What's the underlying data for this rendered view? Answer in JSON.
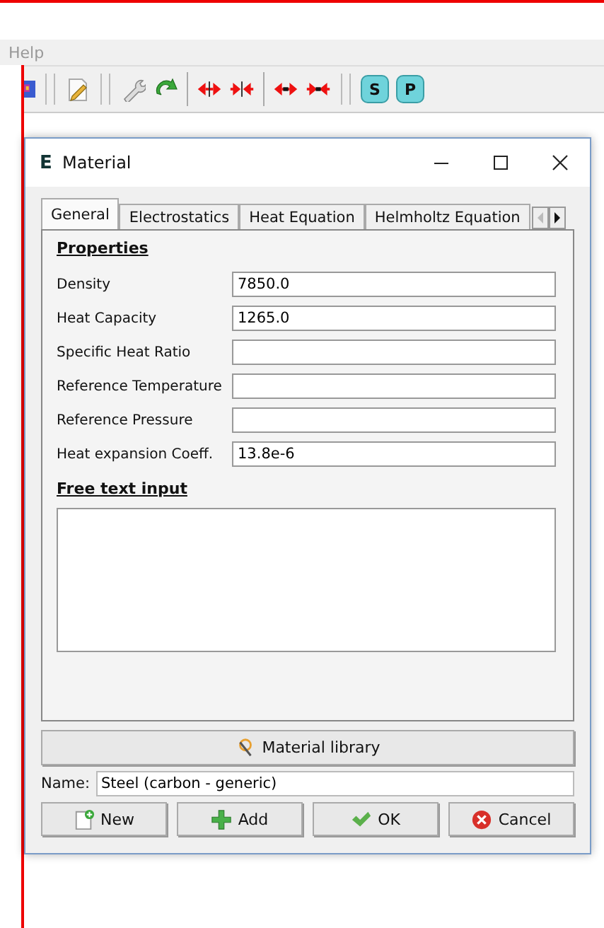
{
  "menu_bar": {
    "items": [
      "Help"
    ]
  },
  "toolbar": {
    "items": [
      {
        "kind": "picture"
      },
      {
        "kind": "sep"
      },
      {
        "kind": "pencil"
      },
      {
        "kind": "sep"
      },
      {
        "kind": "wrench"
      },
      {
        "kind": "redo"
      },
      {
        "kind": "divider"
      },
      {
        "kind": "expand"
      },
      {
        "kind": "shrink"
      },
      {
        "kind": "divider"
      },
      {
        "kind": "expand-dot"
      },
      {
        "kind": "shrink-dot"
      },
      {
        "kind": "sep"
      },
      {
        "kind": "letter",
        "label": "S"
      },
      {
        "kind": "letter",
        "label": "P"
      }
    ]
  },
  "window": {
    "title": "Material",
    "icon_letter": "E"
  },
  "tabs": [
    {
      "label": "General",
      "selected": true
    },
    {
      "label": "Electrostatics",
      "selected": false
    },
    {
      "label": "Heat Equation",
      "selected": false
    },
    {
      "label": "Helmholtz Equation",
      "selected": false
    }
  ],
  "tab_scroll": {
    "left_disabled": true,
    "right_disabled": false
  },
  "section_properties": "Properties",
  "fields": [
    {
      "label": "Density",
      "value": "7850.0"
    },
    {
      "label": "Heat Capacity",
      "value": "1265.0"
    },
    {
      "label": "Specific Heat Ratio"
    },
    {
      "label": "Reference Temperature"
    },
    {
      "label": "Reference Pressure"
    },
    {
      "label": "Heat expansion Coeff.",
      "value": "13.8e-6"
    }
  ],
  "section_free_text": "Free text input",
  "library_button": "Material library",
  "name_field": {
    "label": "Name:",
    "value": "Steel (carbon - generic)"
  },
  "buttons": [
    {
      "kind": "new",
      "label": "New"
    },
    {
      "kind": "add",
      "label": "Add"
    },
    {
      "kind": "ok",
      "label": "OK"
    },
    {
      "kind": "cancel",
      "label": "Cancel"
    }
  ]
}
